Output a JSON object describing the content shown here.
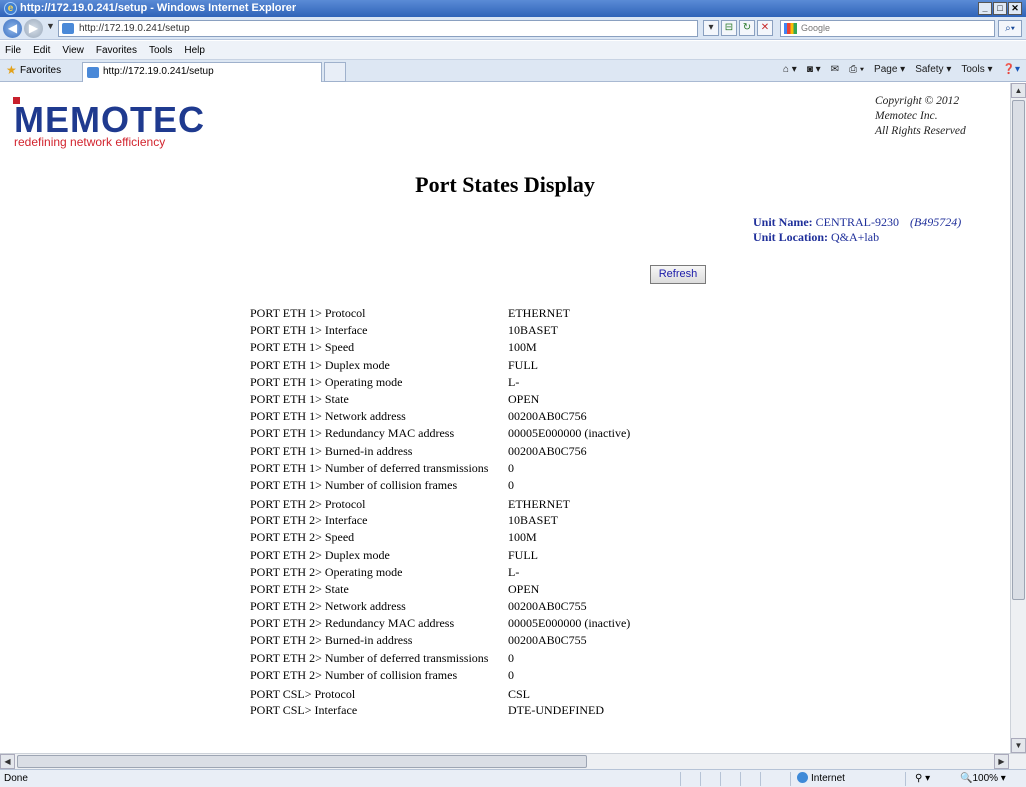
{
  "window": {
    "title": "http://172.19.0.241/setup - Windows Internet Explorer"
  },
  "address_bar": {
    "url": "http://172.19.0.241/setup",
    "search_placeholder": "Google"
  },
  "menu": [
    "File",
    "Edit",
    "View",
    "Favorites",
    "Tools",
    "Help"
  ],
  "favorites_bar": {
    "favorites_label": "Favorites",
    "tab_title": "http://172.19.0.241/setup",
    "commands": [
      "Page ▾",
      "Safety ▾",
      "Tools ▾"
    ]
  },
  "page": {
    "logo": "MEMOTEC",
    "tagline": "redefining network efficiency",
    "copyright": [
      "Copyright © 2012",
      "Memotec Inc.",
      "All Rights Reserved"
    ],
    "title": "Port States Display",
    "unit_name_label": "Unit Name:",
    "unit_name": "CENTRAL-9230",
    "unit_serial": "(B495724)",
    "unit_location_label": "Unit Location:",
    "unit_location": "Q&A+lab",
    "refresh_label": "Refresh",
    "rows": [
      {
        "k": "PORT ETH 1> Protocol",
        "v": "ETHERNET"
      },
      {
        "k": "PORT ETH 1> Interface",
        "v": "10BASET"
      },
      {
        "k": "PORT ETH 1> Speed",
        "v": "100M"
      },
      {
        "k": "PORT ETH 1> Duplex mode",
        "v": "FULL"
      },
      {
        "k": "PORT ETH 1> Operating mode",
        "v": "L-"
      },
      {
        "k": "PORT ETH 1> State",
        "v": "OPEN"
      },
      {
        "k": "PORT ETH 1> Network address",
        "v": "00200AB0C756"
      },
      {
        "k": "PORT ETH 1> Redundancy MAC address",
        "v": "00005E000000 (inactive)"
      },
      {
        "k": "PORT ETH 1> Burned-in address",
        "v": "00200AB0C756"
      },
      {
        "k": "PORT ETH 1> Number of deferred transmissions",
        "v": "0"
      },
      {
        "k": "PORT ETH 1> Number of collision frames",
        "v": "0"
      },
      {
        "k": "PORT ETH 2> Protocol",
        "v": "ETHERNET"
      },
      {
        "k": "PORT ETH 2> Interface",
        "v": "10BASET"
      },
      {
        "k": "PORT ETH 2> Speed",
        "v": "100M"
      },
      {
        "k": "PORT ETH 2> Duplex mode",
        "v": "FULL"
      },
      {
        "k": "PORT ETH 2> Operating mode",
        "v": "L-"
      },
      {
        "k": "PORT ETH 2> State",
        "v": "OPEN"
      },
      {
        "k": "PORT ETH 2> Network address",
        "v": "00200AB0C755"
      },
      {
        "k": "PORT ETH 2> Redundancy MAC address",
        "v": "00005E000000 (inactive)"
      },
      {
        "k": "PORT ETH 2> Burned-in address",
        "v": "00200AB0C755"
      },
      {
        "k": "PORT ETH 2> Number of deferred transmissions",
        "v": "0"
      },
      {
        "k": "PORT ETH 2> Number of collision frames",
        "v": "0"
      },
      {
        "k": "PORT CSL> Protocol",
        "v": "CSL"
      },
      {
        "k": "PORT CSL> Interface",
        "v": "DTE-UNDEFINED"
      }
    ]
  },
  "status": {
    "text": "Done",
    "zone": "Internet",
    "zoom": "100%"
  }
}
